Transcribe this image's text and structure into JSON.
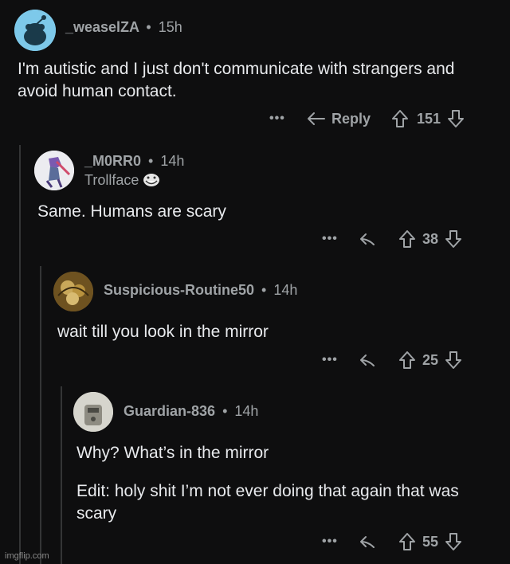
{
  "comments": [
    {
      "username": "_weaselZA",
      "time": "15h",
      "body": "I'm autistic and I just don't communicate with strangers and avoid human contact.",
      "reply_label": "Reply",
      "votes": "151"
    },
    {
      "username": "_M0RR0",
      "time": "14h",
      "flair": "Trollface",
      "body": "Same. Humans are scary",
      "votes": "38"
    },
    {
      "username": "Suspicious-Routine50",
      "time": "14h",
      "body": "wait till you look in the mirror",
      "votes": "25"
    },
    {
      "username": "Guardian-836",
      "time": "14h",
      "body_1": "Why? What’s in the mirror",
      "body_2": "Edit: holy shit I’m not ever doing that again that was scary",
      "votes": "55"
    }
  ],
  "separator": "•",
  "more_label": "•••",
  "watermark": "imgflip.com",
  "colors": {
    "background": "#0e0e0f",
    "text": "#e8eaed",
    "muted": "#9fa3a6",
    "thread_line": "#343536",
    "snoo_blue": "#7dc9ea"
  }
}
